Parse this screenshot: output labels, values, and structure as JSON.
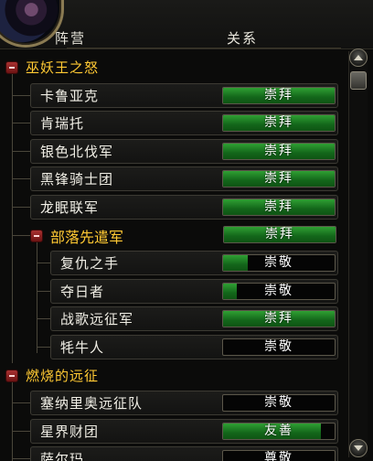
{
  "header": {
    "faction_label": "阵营",
    "relation_label": "关系"
  },
  "colors": {
    "category": "#ffc933",
    "bar_fill": "#13661a",
    "text": "#f1efe6"
  },
  "rows": [
    {
      "kind": "category",
      "name": "巫妖王之怒"
    },
    {
      "kind": "faction",
      "name": "卡鲁亚克",
      "standing": "崇拜",
      "progress": 1.0
    },
    {
      "kind": "faction",
      "name": "肯瑞托",
      "standing": "崇拜",
      "progress": 1.0
    },
    {
      "kind": "faction",
      "name": "银色北伐军",
      "standing": "崇拜",
      "progress": 1.0
    },
    {
      "kind": "faction",
      "name": "黑锋骑士团",
      "standing": "崇拜",
      "progress": 1.0
    },
    {
      "kind": "faction",
      "name": "龙眠联军",
      "standing": "崇拜",
      "progress": 1.0
    },
    {
      "kind": "subgroup",
      "name": "部落先遣军",
      "standing": "崇拜",
      "progress": 1.0
    },
    {
      "kind": "subfaction",
      "name": "复仇之手",
      "standing": "崇敬",
      "progress": 0.22
    },
    {
      "kind": "subfaction",
      "name": "夺日者",
      "standing": "崇敬",
      "progress": 0.12
    },
    {
      "kind": "subfaction",
      "name": "战歌远征军",
      "standing": "崇拜",
      "progress": 1.0
    },
    {
      "kind": "subfaction",
      "name": "牦牛人",
      "standing": "崇敬",
      "progress": 0.0
    },
    {
      "kind": "category",
      "name": "燃烧的远征"
    },
    {
      "kind": "faction",
      "name": "塞纳里奥远征队",
      "standing": "崇敬",
      "progress": 0.0
    },
    {
      "kind": "faction",
      "name": "星界财团",
      "standing": "友善",
      "progress": 0.88
    },
    {
      "kind": "faction",
      "name": "萨尔玛",
      "standing": "尊敬",
      "progress": 0.0
    }
  ]
}
